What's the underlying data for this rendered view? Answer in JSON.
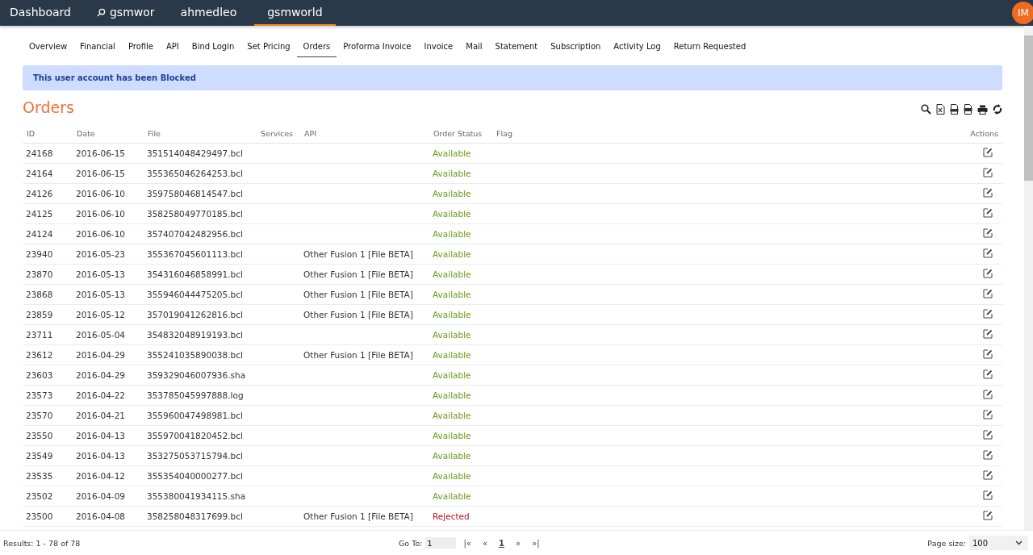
{
  "topbar": {
    "items": [
      {
        "label": "Dashboard",
        "kind": "plain",
        "selected": false
      },
      {
        "label": "gsmwor",
        "kind": "search",
        "selected": false
      },
      {
        "label": "ahmedleo",
        "kind": "plain",
        "selected": false
      },
      {
        "label": "gsmworld",
        "kind": "plain",
        "selected": true
      }
    ],
    "avatar": "IM"
  },
  "tabs": [
    {
      "label": "Overview",
      "selected": false
    },
    {
      "label": "Financial",
      "selected": false
    },
    {
      "label": "Profile",
      "selected": false
    },
    {
      "label": "API",
      "selected": false
    },
    {
      "label": "Bind Login",
      "selected": false
    },
    {
      "label": "Set Pricing",
      "selected": false
    },
    {
      "label": "Orders",
      "selected": true
    },
    {
      "label": "Proforma Invoice",
      "selected": false
    },
    {
      "label": "Invoice",
      "selected": false
    },
    {
      "label": "Mail",
      "selected": false
    },
    {
      "label": "Statement",
      "selected": false
    },
    {
      "label": "Subscription",
      "selected": false
    },
    {
      "label": "Activity Log",
      "selected": false
    },
    {
      "label": "Return Requested",
      "selected": false
    }
  ],
  "alert": "This user account has been Blocked",
  "title": "Orders",
  "table": {
    "columns": [
      "ID",
      "Date",
      "File",
      "Services",
      "API",
      "Order Status",
      "Flag",
      "Actions"
    ],
    "rows": [
      {
        "id": "24168",
        "date": "2016-06-15",
        "file": "351514048429497.bcl",
        "api": "",
        "status": "Available",
        "kind": "available"
      },
      {
        "id": "24164",
        "date": "2016-06-15",
        "file": "355365046264253.bcl",
        "api": "",
        "status": "Available",
        "kind": "available"
      },
      {
        "id": "24126",
        "date": "2016-06-10",
        "file": "359758046814547.bcl",
        "api": "",
        "status": "Available",
        "kind": "available"
      },
      {
        "id": "24125",
        "date": "2016-06-10",
        "file": "358258049770185.bcl",
        "api": "",
        "status": "Available",
        "kind": "available"
      },
      {
        "id": "24124",
        "date": "2016-06-10",
        "file": "357407042482956.bcl",
        "api": "",
        "status": "Available",
        "kind": "available"
      },
      {
        "id": "23940",
        "date": "2016-05-23",
        "file": "355367045601113.bcl",
        "api": "Other Fusion 1 [File BETA]",
        "status": "Available",
        "kind": "available"
      },
      {
        "id": "23870",
        "date": "2016-05-13",
        "file": "354316046858991.bcl",
        "api": "Other Fusion 1 [File BETA]",
        "status": "Available",
        "kind": "available"
      },
      {
        "id": "23868",
        "date": "2016-05-13",
        "file": "355946044475205.bcl",
        "api": "Other Fusion 1 [File BETA]",
        "status": "Available",
        "kind": "available"
      },
      {
        "id": "23859",
        "date": "2016-05-12",
        "file": "357019041262816.bcl",
        "api": "Other Fusion 1 [File BETA]",
        "status": "Available",
        "kind": "available"
      },
      {
        "id": "23711",
        "date": "2016-05-04",
        "file": "354832048919193.bcl",
        "api": "",
        "status": "Available",
        "kind": "available"
      },
      {
        "id": "23612",
        "date": "2016-04-29",
        "file": "355241035890038.bcl",
        "api": "Other Fusion 1 [File BETA]",
        "status": "Available",
        "kind": "available"
      },
      {
        "id": "23603",
        "date": "2016-04-29",
        "file": "359329046007936.sha",
        "api": "",
        "status": "Available",
        "kind": "available"
      },
      {
        "id": "23573",
        "date": "2016-04-22",
        "file": "353785045997888.log",
        "api": "",
        "status": "Available",
        "kind": "available"
      },
      {
        "id": "23570",
        "date": "2016-04-21",
        "file": "355960047498981.bcl",
        "api": "",
        "status": "Available",
        "kind": "available"
      },
      {
        "id": "23550",
        "date": "2016-04-13",
        "file": "355970041820452.bcl",
        "api": "",
        "status": "Available",
        "kind": "available"
      },
      {
        "id": "23549",
        "date": "2016-04-13",
        "file": "353275053715794.bcl",
        "api": "",
        "status": "Available",
        "kind": "available"
      },
      {
        "id": "23535",
        "date": "2016-04-12",
        "file": "355354040000277.bcl",
        "api": "",
        "status": "Available",
        "kind": "available"
      },
      {
        "id": "23502",
        "date": "2016-04-09",
        "file": "355380041934115.sha",
        "api": "",
        "status": "Available",
        "kind": "available"
      },
      {
        "id": "23500",
        "date": "2016-04-08",
        "file": "358258048317699.bcl",
        "api": "Other Fusion 1 [File BETA]",
        "status": "Rejected",
        "kind": "rejected"
      }
    ]
  },
  "footer": {
    "results": "Results: 1 - 78 of 78",
    "goto_label": "Go To:",
    "goto_value": "1",
    "pager": [
      {
        "label": "|«",
        "selected": false
      },
      {
        "label": "«",
        "selected": false
      },
      {
        "label": "1",
        "selected": true
      },
      {
        "label": "»",
        "selected": false
      },
      {
        "label": "»|",
        "selected": false
      }
    ],
    "page_size_label": "Page size:",
    "page_size": "100"
  }
}
